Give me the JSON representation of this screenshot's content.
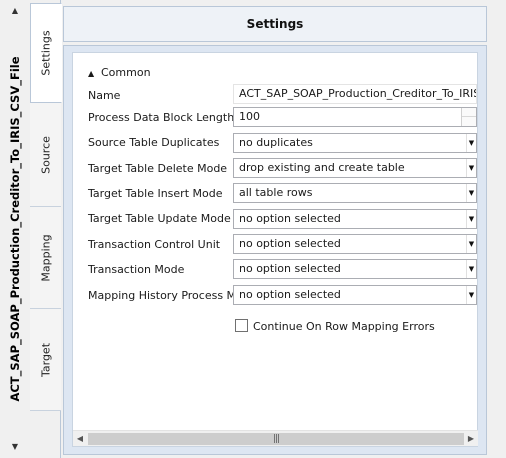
{
  "window": {
    "vertical_title": "ACT_SAP_SOAP_Production_Creditor_To_IRIS_CSV_File"
  },
  "tabs": [
    {
      "label": "Settings",
      "active": true
    },
    {
      "label": "Source",
      "active": false
    },
    {
      "label": "Mapping",
      "active": false
    },
    {
      "label": "Target",
      "active": false
    }
  ],
  "header": {
    "title": "Settings"
  },
  "section": {
    "label": "Common",
    "expanded": true
  },
  "properties": [
    {
      "label": "Name",
      "value": "ACT_SAP_SOAP_Production_Creditor_To_IRIS_CSV_File",
      "kind": "text"
    },
    {
      "label": "Process Data Block Length",
      "value": "100",
      "kind": "spinner"
    },
    {
      "label": "Source Table Duplicates",
      "value": "no duplicates",
      "kind": "dropdown"
    },
    {
      "label": "Target Table Delete Mode",
      "value": "drop existing and create table",
      "kind": "dropdown"
    },
    {
      "label": "Target Table Insert Mode",
      "value": "all table rows",
      "kind": "dropdown"
    },
    {
      "label": "Target Table Update Mode",
      "value": "no option selected",
      "kind": "dropdown"
    },
    {
      "label": "Transaction Control Unit",
      "value": "no option selected",
      "kind": "dropdown"
    },
    {
      "label": "Transaction Mode",
      "value": "no option selected",
      "kind": "dropdown"
    },
    {
      "label": "Mapping History Process Mode",
      "value": "no option selected",
      "kind": "dropdown"
    }
  ],
  "checkbox": {
    "label": "Continue On Row Mapping Errors",
    "checked": false
  },
  "icons": {
    "collapse": "caret-up-icon",
    "dropdown": "chevron-down-icon",
    "scroll_left": "chevron-left-icon",
    "scroll_right": "chevron-right-icon"
  }
}
